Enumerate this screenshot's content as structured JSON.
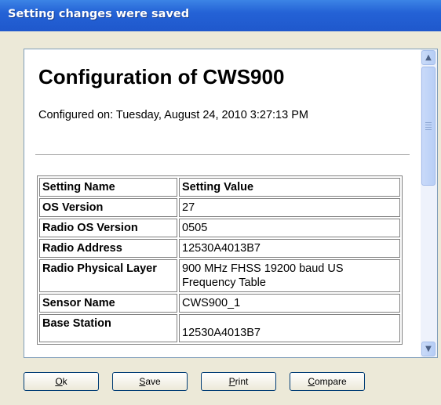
{
  "window": {
    "title": "Setting changes were saved"
  },
  "document": {
    "heading": "Configuration of CWS900",
    "configured_on": "Configured on: Tuesday, August 24, 2010 3:27:13 PM"
  },
  "table": {
    "headers": [
      "Setting Name",
      "Setting Value"
    ],
    "rows": [
      {
        "name": "OS Version",
        "value": "27"
      },
      {
        "name": "Radio OS Version",
        "value": "0505"
      },
      {
        "name": "Radio Address",
        "value": "12530A4013B7"
      },
      {
        "name": "Radio Physical Layer",
        "value": "900 MHz FHSS 19200 baud US Frequency Table"
      },
      {
        "name": "Sensor Name",
        "value": "CWS900_1"
      },
      {
        "name": "Base Station",
        "value": "12530A4013B7"
      }
    ]
  },
  "buttons": {
    "ok": {
      "mnemonic": "O",
      "rest": "k"
    },
    "save": {
      "mnemonic": "S",
      "rest": "ave"
    },
    "print": {
      "mnemonic": "P",
      "rest": "rint"
    },
    "compare": {
      "mnemonic": "C",
      "rest": "ompare"
    }
  },
  "icons": {
    "scroll_up": "chevron-up-icon",
    "scroll_down": "chevron-down-icon"
  }
}
